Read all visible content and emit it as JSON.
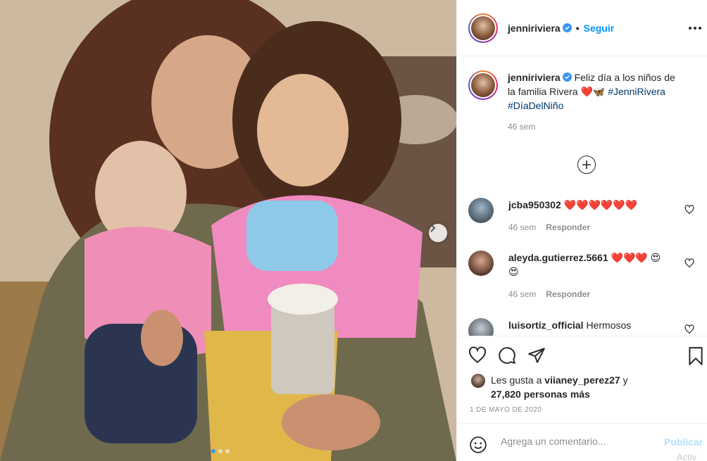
{
  "post": {
    "author": "jenniriviera",
    "follow_label": "Seguir",
    "caption_user": "jenniriviera",
    "caption_text": "Feliz día a los niños de la familia Rivera ❤️🦋",
    "hashtag1": "#JenniRivera",
    "hashtag2": "#DíaDelNiño",
    "caption_time": "46 sem"
  },
  "comments": [
    {
      "user": "jcba950302",
      "text": "❤️❤️❤️❤️❤️❤️",
      "time": "46 sem",
      "reply": "Responder"
    },
    {
      "user": "aleyda.gutierrez.5661",
      "text": "❤️❤️❤️ 😍😍",
      "time": "46 sem",
      "reply": "Responder"
    },
    {
      "user": "luisortiz_official",
      "text": "Hermosos"
    }
  ],
  "likes": {
    "prefix": "Les gusta a",
    "liker": "viianey_perez27",
    "connector": "y",
    "count": "27,820 personas más"
  },
  "date": "1 DE MAYO DE 2020",
  "comment_box": {
    "placeholder": "Agrega un comentario...",
    "publish": "Publicar"
  },
  "watermark": "Activ",
  "colors": {
    "link": "#0095f6",
    "hashtag": "#00376b",
    "muted": "#8e8e8e",
    "carousel_active": "#3897f0"
  }
}
